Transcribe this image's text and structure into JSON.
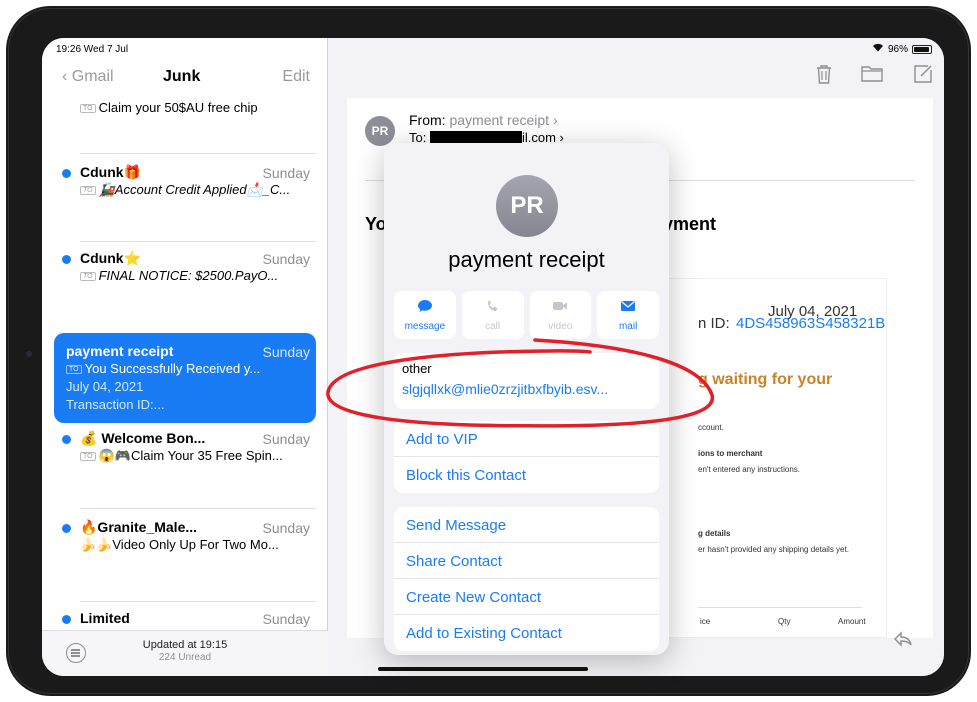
{
  "status_bar": {
    "time": "19:26 Wed 7 Jul",
    "battery": "96%"
  },
  "sidebar": {
    "back_label": "Gmail",
    "title": "Junk",
    "edit_label": "Edit",
    "partial_subject": "Claim your 50$AU free chip",
    "mails": [
      {
        "sender": "Cdunk🎁",
        "date": "Sunday",
        "subject": "🚂Account Credit Applied📩_C..."
      },
      {
        "sender": "Cdunk⭐",
        "date": "Sunday",
        "subject": "FINAL NOTICE: $2500.PayO..."
      },
      {
        "sender": "payment receipt",
        "date": "Sunday",
        "subject": "You Successfully Received y...",
        "line3": "July 04, 2021",
        "line4": "Transaction ID:..."
      },
      {
        "sender": "💰 Welcome Bon...",
        "date": "Sunday",
        "subject": "😱🎮Claim Your 35 Free Spin..."
      },
      {
        "sender": "🔥Granite_Male...",
        "date": "Sunday",
        "subject": "🍌🍌Video Only Up For Two Mo..."
      },
      {
        "sender": "Limited",
        "date": "Sunday"
      }
    ],
    "bottom": {
      "updated": "Updated at 19:15",
      "unread": "224 Unread"
    }
  },
  "detail": {
    "from_label": "From:",
    "from_name": "payment receipt",
    "to_label": "To:",
    "to_suffix": "il.com",
    "subject_left": "Yo",
    "subject_right": "r payment",
    "inner": {
      "date": "July 04, 2021",
      "txn_prefix": "n ID:",
      "txn_id": "4DS458963S458321B",
      "waiting": "g waiting for your",
      "account": "ccount.",
      "instr_head": "ions to merchant",
      "instr_body": "en't entered any instructions.",
      "ship_head": "g details",
      "ship_body": "er hasn't provided any shipping details yet.",
      "col_price": "ice",
      "col_qty": "Qty",
      "col_amount": "Amount"
    }
  },
  "contact_card": {
    "initials": "PR",
    "name": "payment receipt",
    "actions": [
      {
        "label": "message",
        "icon": "speech-bubble-icon",
        "enabled": true
      },
      {
        "label": "call",
        "icon": "phone-icon",
        "enabled": false
      },
      {
        "label": "video",
        "icon": "video-camera-icon",
        "enabled": false
      },
      {
        "label": "mail",
        "icon": "envelope-icon",
        "enabled": true
      }
    ],
    "email_label": "other",
    "email_value": "slgjqllxk@mlie0zrzjitbxfbyib.esv...",
    "group1": [
      "Add to VIP",
      "Block this Contact"
    ],
    "group2": [
      "Send Message",
      "Share Contact",
      "Create New Contact",
      "Add to Existing Contact"
    ]
  },
  "colors": {
    "accent": "#1a7cf5",
    "annotation": "#e2202a",
    "subject_orange": "#c7832a"
  }
}
